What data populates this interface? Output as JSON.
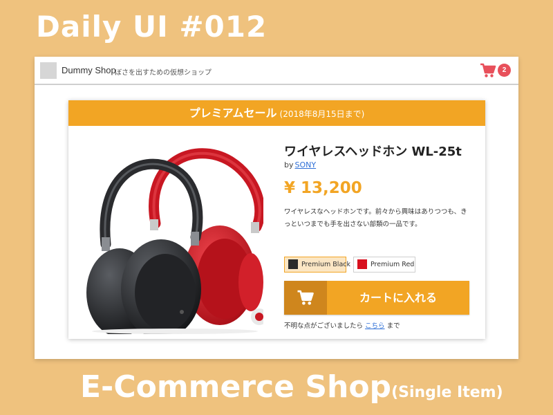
{
  "page": {
    "heading": "Daily UI #012",
    "subtitle_main": "E-Commerce Shop",
    "subtitle_suffix": "(Single Item)"
  },
  "header": {
    "shop_name": "Dummy Shop",
    "tagline": "ぼさを出すための仮想ショップ",
    "cart_count": "2",
    "cart_icon": "shopping-cart"
  },
  "sale": {
    "title": "プレミアムセール",
    "period": "(2018年8月15日まで)"
  },
  "product": {
    "name": "ワイヤレスヘッドホン WL-25t",
    "brand_prefix": "by",
    "brand": "SONY",
    "price": "¥ 13,200",
    "description": "ワイヤレスなヘッドホンです。前々から興味はありつつも、きっといつまでも手を出さない部類の一品です。",
    "variants": [
      {
        "label": "Premium Black",
        "color": "#2b2b2b",
        "selected": true
      },
      {
        "label": "Premium Red",
        "color": "#D8101E",
        "selected": false
      }
    ],
    "add_to_cart": "カートに入れる",
    "help_prefix": "不明な点がございましたら ",
    "help_link": "こちら",
    "help_suffix": " まで"
  },
  "colors": {
    "accent": "#F2A524",
    "accent_dark": "#CF861D",
    "badge": "#E8505B",
    "background": "#EFC27E",
    "link": "#2E6FD6"
  }
}
